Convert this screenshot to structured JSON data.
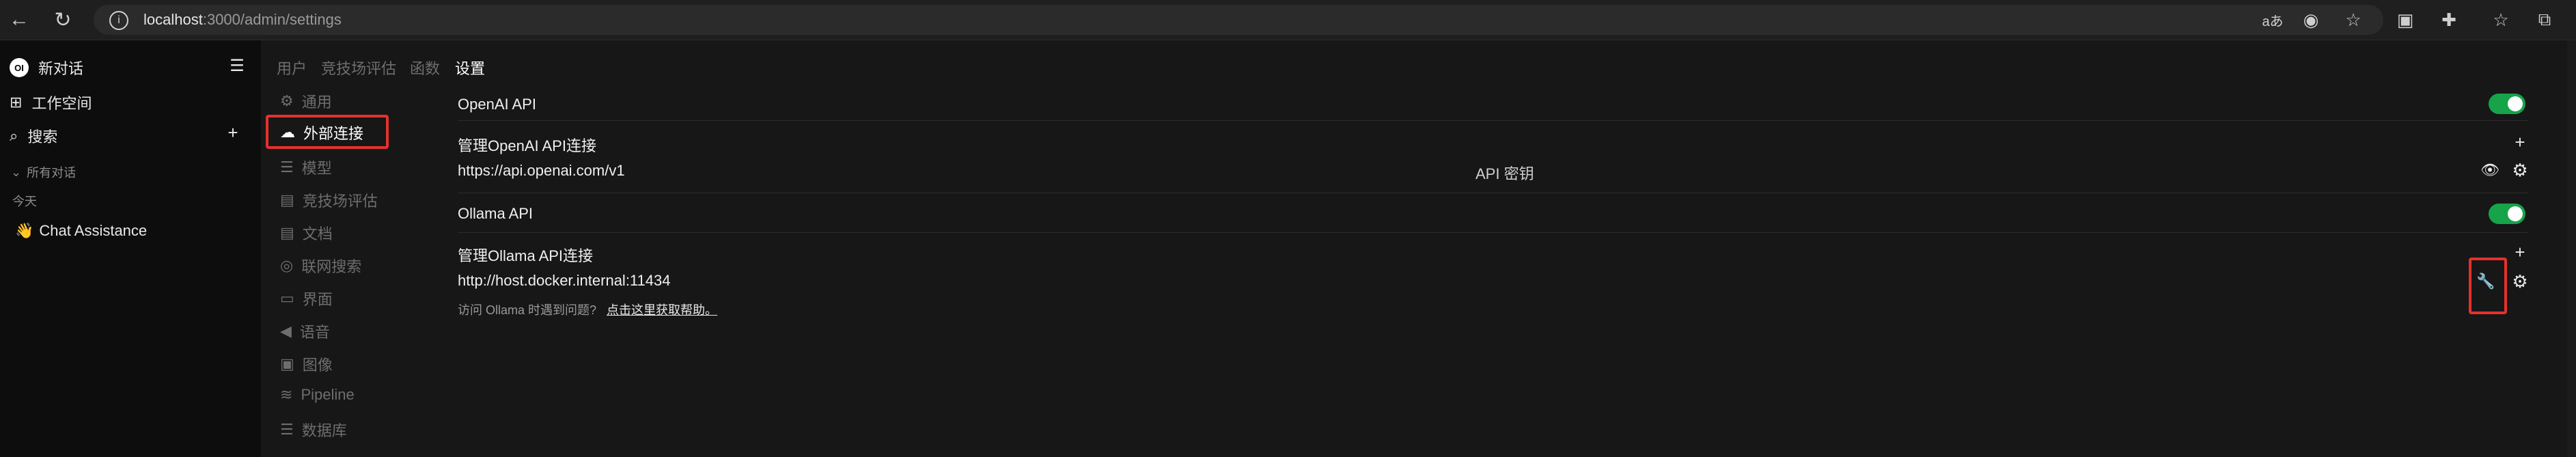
{
  "browser": {
    "url_host": "localhost",
    "url_rest": ":3000/admin/settings"
  },
  "sidebar": {
    "logo": "OI",
    "new_chat": "新对话",
    "workspace": "工作空间",
    "search": "搜索",
    "all_chats": "所有对话",
    "today": "今天",
    "chats": [
      {
        "emoji": "👋",
        "title": "Chat Assistance"
      }
    ]
  },
  "topnav": {
    "tabs": [
      "用户",
      "竞技场评估",
      "函数",
      "设置"
    ]
  },
  "settings_nav": {
    "items": [
      {
        "label": "通用"
      },
      {
        "label": "外部连接"
      },
      {
        "label": "模型"
      },
      {
        "label": "竞技场评估"
      },
      {
        "label": "文档"
      },
      {
        "label": "联网搜索"
      },
      {
        "label": "界面"
      },
      {
        "label": "语音"
      },
      {
        "label": "图像"
      },
      {
        "label": "Pipeline"
      },
      {
        "label": "数据库"
      }
    ],
    "active": "外部连接"
  },
  "openai": {
    "title": "OpenAI API",
    "enabled": true,
    "manage_label": "管理OpenAI API连接",
    "url": "https://api.openai.com/v1",
    "key_placeholder": "API 密钥"
  },
  "ollama": {
    "title": "Ollama API",
    "enabled": true,
    "manage_label": "管理Ollama API连接",
    "url": "http://host.docker.internal:11434",
    "help_prefix": "访问 Ollama 时遇到问题?",
    "help_link": "点击这里获取帮助。"
  },
  "colors": {
    "toggle_on": "#16a34a",
    "highlight": "#e5312d",
    "background": "#171717",
    "sidebar_bg": "#0d0d0d"
  }
}
